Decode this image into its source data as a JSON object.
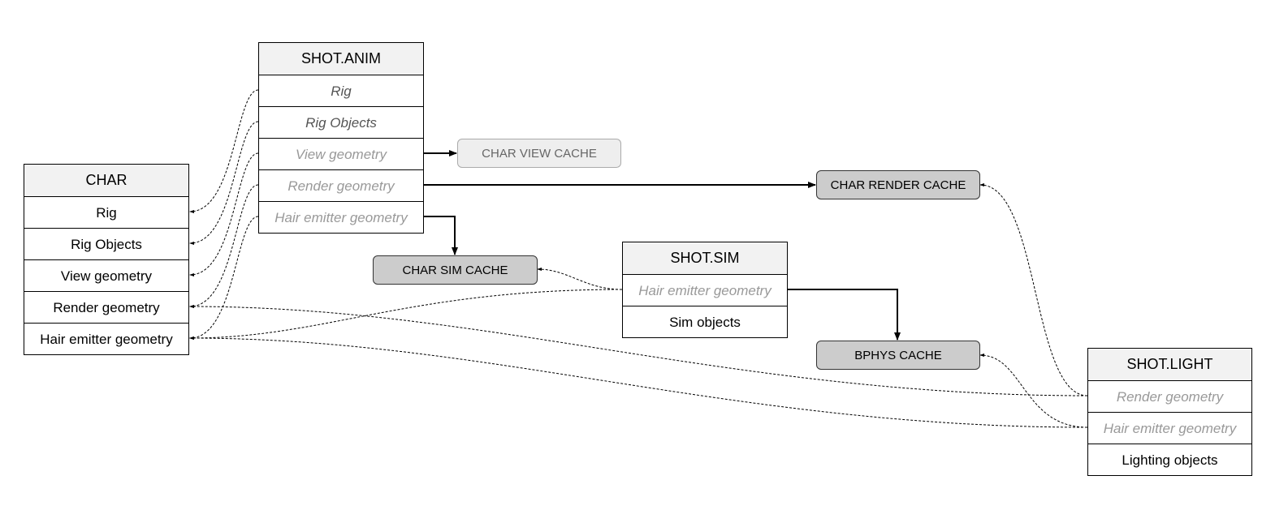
{
  "tables": {
    "char": {
      "title": "CHAR",
      "rows": [
        "Rig",
        "Rig Objects",
        "View geometry",
        "Render geometry",
        "Hair emitter geometry"
      ]
    },
    "shot_anim": {
      "title": "SHOT.ANIM",
      "rows": [
        "Rig",
        "Rig Objects",
        "View geometry",
        "Render geometry",
        "Hair emitter geometry"
      ]
    },
    "shot_sim": {
      "title": "SHOT.SIM",
      "rows": [
        "Hair emitter geometry",
        "Sim objects"
      ]
    },
    "shot_light": {
      "title": "SHOT.LIGHT",
      "rows": [
        "Render geometry",
        "Hair emitter geometry",
        "Lighting objects"
      ]
    }
  },
  "caches": {
    "view": "CHAR VIEW CACHE",
    "render": "CHAR RENDER CACHE",
    "sim": "CHAR SIM CACHE",
    "bphys": "BPHYS CACHE"
  },
  "colors": {
    "header_fill": "#f2f2f2",
    "cache_fill": "#cccccc",
    "view_cache_fill": "#eeeeee",
    "linked_text": "#999999",
    "overridden_text": "#555555"
  }
}
